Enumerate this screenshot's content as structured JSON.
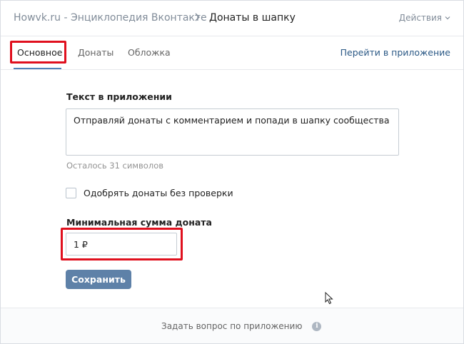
{
  "header": {
    "breadcrumb_parent": "Howvk.ru - Энциклопедия Вконтакте",
    "breadcrumb_separator": ">",
    "breadcrumb_current": "Донаты в шапку",
    "actions_label": "Действия",
    "actions_icon": "chevron-down-icon"
  },
  "tabs": {
    "items": [
      {
        "label": "Основное",
        "active": true
      },
      {
        "label": "Донаты",
        "active": false
      },
      {
        "label": "Обложка",
        "active": false
      }
    ],
    "open_app_label": "Перейти в приложение"
  },
  "form": {
    "app_text_label": "Текст в приложении",
    "app_text_value": "Отправляй донаты с комментарием и попади в шапку сообщества",
    "chars_left": "Осталось 31 символов",
    "approve_checkbox_label": "Одобрять донаты без проверки",
    "approve_checked": false,
    "min_amount_label": "Минимальная сумма доната",
    "min_amount_value": "1 ₽",
    "save_label": "Сохранить"
  },
  "footer": {
    "ask_question_label": "Задать вопрос по приложению",
    "info_icon": "i"
  },
  "colors": {
    "accent": "#5181b8",
    "link": "#2a5885",
    "button": "#5e81a8",
    "highlight": "#e0101e"
  }
}
